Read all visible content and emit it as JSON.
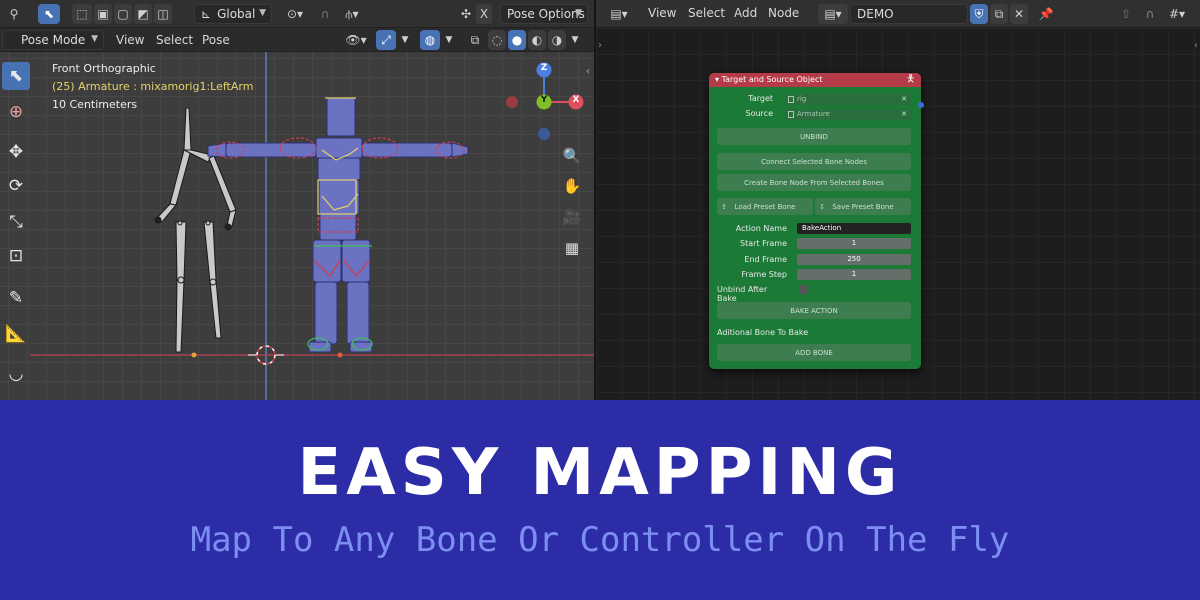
{
  "viewport": {
    "header": {
      "transform_orientation": "Global",
      "pose_options": "Pose Options"
    },
    "header2": {
      "mode": "Pose Mode",
      "menus": [
        "View",
        "Select",
        "Pose"
      ]
    },
    "overlay": {
      "view_name": "Front Orthographic",
      "active_object": "(25) Armature : mixamorig1:LeftArm",
      "scale": "10 Centimeters"
    },
    "gizmo": {
      "z": "Z",
      "y": "Y",
      "x": "X"
    }
  },
  "node_editor": {
    "menus": [
      "View",
      "Select",
      "Add",
      "Node"
    ],
    "tree_name": "DEMO",
    "node": {
      "title": "Target and Source Object",
      "target_label": "Target",
      "target_value": "rig",
      "source_label": "Source",
      "source_value": "Armature",
      "unbind_button": "UNBIND",
      "connect_button": "Connect Selected Bone Nodes",
      "create_button": "Create Bone Node From Selected Bones",
      "load_preset": "Load Preset Bone",
      "save_preset": "Save Preset Bone",
      "action_name_label": "Action Name",
      "action_name_value": "BakeAction",
      "start_frame_label": "Start Frame",
      "start_frame_value": "1",
      "end_frame_label": "End Frame",
      "end_frame_value": "250",
      "frame_step_label": "Frame Step",
      "frame_step_value": "1",
      "unbind_after_bake_label": "Unbind After Bake",
      "unbind_after_bake_checked": false,
      "bake_button": "BAKE ACTION",
      "additional_label": "Aditional Bone To Bake",
      "add_bone_button": "ADD BONE"
    }
  },
  "banner": {
    "title": "EASY MAPPING",
    "subtitle": "Map To Any Bone Or Controller On The Fly"
  },
  "colors": {
    "banner_bg": "#2d2ca7",
    "subtitle": "#7c8ef2",
    "node_body": "#1c7a37",
    "node_header": "#b53b48",
    "active_blue": "#4772b3"
  }
}
